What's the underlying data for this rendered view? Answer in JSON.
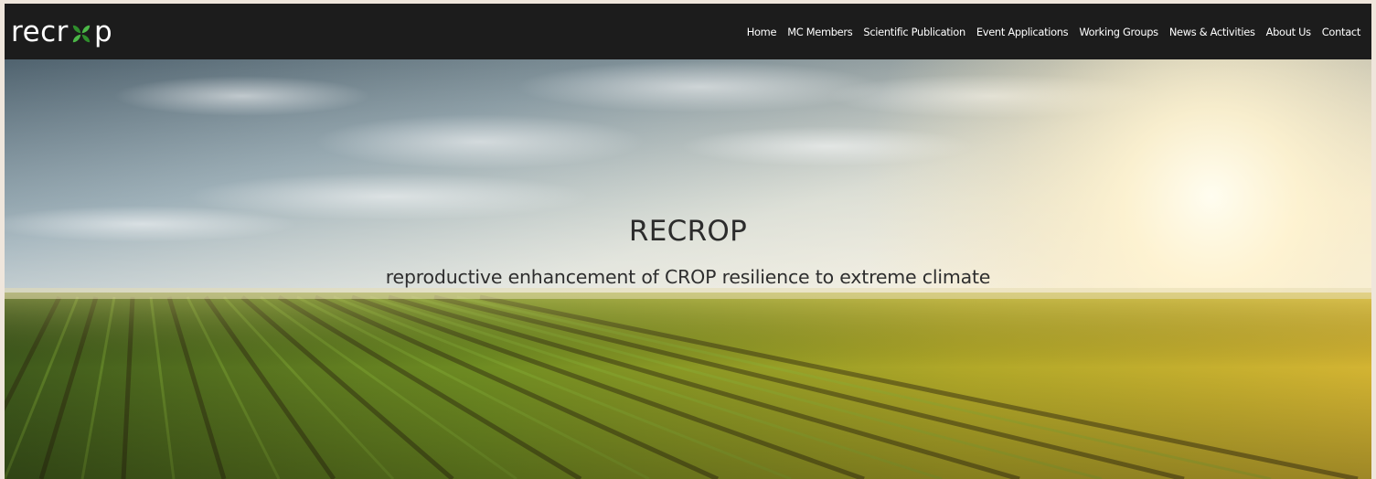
{
  "brand": {
    "logo_left": "recr",
    "logo_right": "p",
    "logo_icon": "leaf-o-icon",
    "accent_green": "#3fae3a",
    "navbar_bg": "#1c1c1c"
  },
  "nav": {
    "items": [
      {
        "label": "Home"
      },
      {
        "label": "MC Members"
      },
      {
        "label": "Scientific Publication"
      },
      {
        "label": "Event Applications"
      },
      {
        "label": "Working Groups"
      },
      {
        "label": "News & Activities"
      },
      {
        "label": "About Us"
      },
      {
        "label": "Contact"
      }
    ]
  },
  "hero": {
    "title": "RECROP",
    "subtitle": "reproductive enhancement of CROP resilience to extreme climate",
    "image": "crop-field-sunset-photo"
  }
}
